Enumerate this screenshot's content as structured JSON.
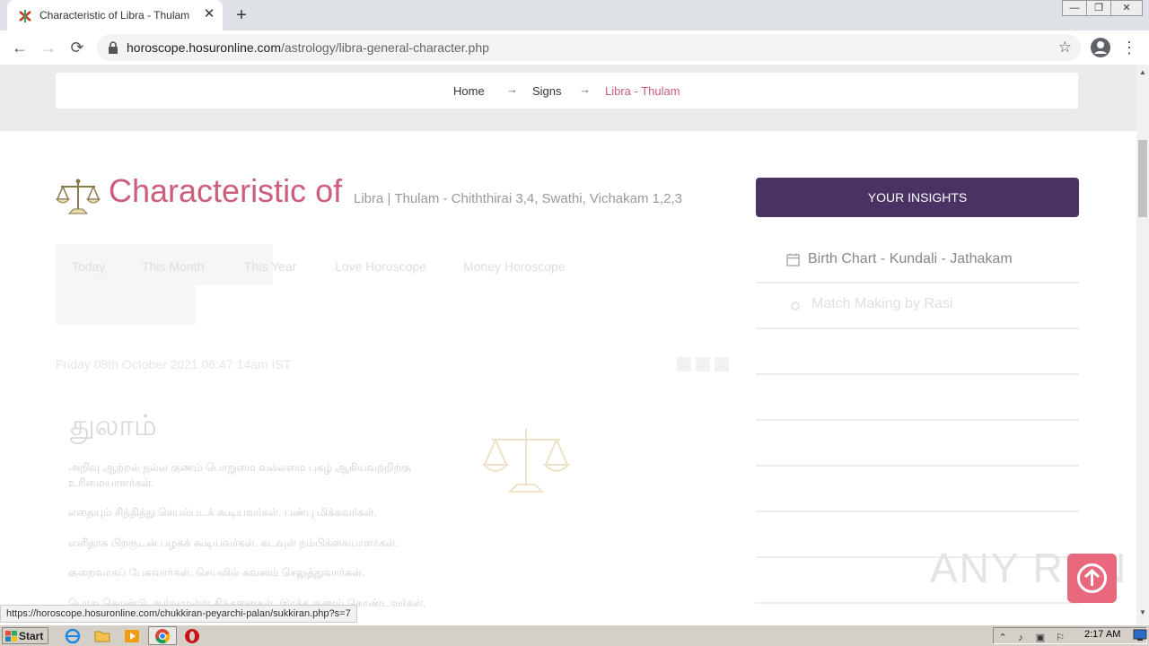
{
  "browser": {
    "tab_title": "Characteristic of Libra - Thulam",
    "close_glyph": "✕",
    "new_tab_glyph": "+",
    "url_domain": "horoscope.hosuronline.com",
    "url_path": "/astrology/libra-general-character.php",
    "nav": {
      "back": "←",
      "forward": "→",
      "reload": "⟳"
    },
    "star_glyph": "☆",
    "menu_glyph": "⋮",
    "window_buttons": [
      "—",
      "❐",
      "✕"
    ]
  },
  "breadcrumb": {
    "home": "Home",
    "signs": "Signs",
    "current": "Libra - Thulam",
    "separator": "→"
  },
  "page": {
    "heading": "Characteristic of",
    "subheading": "Libra | Thulam - Chiththirai 3,4, Swathi, Vichakam 1,2,3",
    "tabs": [
      "Today",
      "This Month",
      "This Year",
      "Love Horoscope",
      "Money Horoscope"
    ],
    "date": "Friday 08th October 2021 06:47:14am IST",
    "tamil_title": "துலாம்",
    "tamil_lines": [
      "அறிவு ஆற்றல் நல்ல குணம் பொறுமை வல்லமை புகழ் ஆகியவற்றிற்கு",
      "உரிமையாளர்கள்.",
      "எதையும் சிந்தித்து செயல்படக் கூடியவர்கள்.   பண்பு மிக்கவர்கள்.",
      "எளிதாக பிறருடன் பழகக் கூடியவர்கள்.   கடவுள் நம்பிக்கையாளர்கள்.",
      "குறைவாகப் பேசுவார்கள்.   செயலில் கவனம் செலுத்துவார்கள்.",
      "பொது தொண்டு ஆர்வமுள்ள சிந்தனைகள்.   இரக்க குணம் கொண்டவர்கள்."
    ]
  },
  "sidebar": {
    "insights_label": "YOUR INSIGHTS",
    "items": [
      {
        "label": "Birth Chart - Kundali - Jathakam",
        "icon": "calendar-icon"
      },
      {
        "label": "Match Making by Rasi",
        "icon": "eye-icon"
      }
    ]
  },
  "watermark": "ANY RUN",
  "status_link": "https://horoscope.hosuronline.com/chukkiran-peyarchi-palan/sukkiran.php?s=7",
  "taskbar": {
    "start_label": "Start",
    "clock": "2:17 AM"
  },
  "colors": {
    "accent_pink": "#cc5d7b",
    "insights_purple": "#4a3263",
    "totop_red": "#e8697e"
  }
}
